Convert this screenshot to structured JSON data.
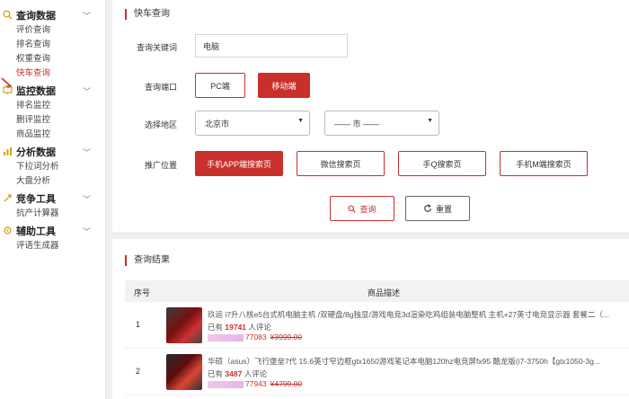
{
  "sidebar": {
    "groups": [
      {
        "label": "查询数据",
        "items": [
          "评价查询",
          "排名查询",
          "权重查询",
          "快车查询"
        ]
      },
      {
        "label": "监控数据",
        "items": [
          "排名监控",
          "删评监控",
          "商品监控"
        ]
      },
      {
        "label": "分析数据",
        "items": [
          "下拉词分析",
          "大盘分析"
        ]
      },
      {
        "label": "竞争工具",
        "items": [
          "抗产计算器"
        ]
      },
      {
        "label": "辅助工具",
        "items": [
          "评语生成器"
        ]
      }
    ],
    "active_item": "快车查询"
  },
  "query_panel": {
    "title": "快车查询",
    "keyword_label": "查询关键词",
    "keyword_value": "电脑",
    "port_label": "查询端口",
    "port_options": [
      "PC端",
      "移动端"
    ],
    "port_selected": "移动端",
    "region_label": "选择地区",
    "province_value": "北京市",
    "city_value": "—— 市 ——",
    "position_label": "推广位置",
    "position_options": [
      "手机APP端搜索页",
      "微信搜索页",
      "手Q搜索页",
      "手机M端搜索页"
    ],
    "position_selected": "手机APP端搜索页",
    "search_button": "查询",
    "reset_button": "重置"
  },
  "results_panel": {
    "title": "查询结果",
    "columns": [
      "序号",
      "商品描述"
    ],
    "rows": [
      {
        "index": "1",
        "desc": "玖运 i7升八核e5台式机电脑主机 /双硬盘/8g独显/游戏电竞3d渲染吃鸡组装电脑整机 主机+27英寸电竞显示器 套餐二（...",
        "meta_prefix": "已有",
        "reviews": "19741",
        "meta_suffix": "人评论",
        "price": "77083",
        "original": "¥3999.00"
      },
      {
        "index": "2",
        "desc": "华硕（asus）飞行堡垒7代 15.6英寸窄边框gtx1650游戏笔记本电脑120hz电竞屏fx95 酷龙版(i7-3750h【gtx1050-3g...",
        "meta_prefix": "已有",
        "reviews": "3487",
        "meta_suffix": "人评论",
        "price": "77943",
        "original": "¥4799.00"
      }
    ]
  },
  "colors": {
    "accent": "#c9302c",
    "panel_bg": "#ffffff",
    "page_bg": "#f0f0f0"
  },
  "icons": [
    "search-data-icon",
    "monitor-data-icon",
    "analysis-data-icon",
    "competition-tool-icon",
    "assist-tool-icon",
    "chevron-down-icon",
    "search-icon",
    "refresh-icon",
    "pointer-arrow-icon"
  ]
}
